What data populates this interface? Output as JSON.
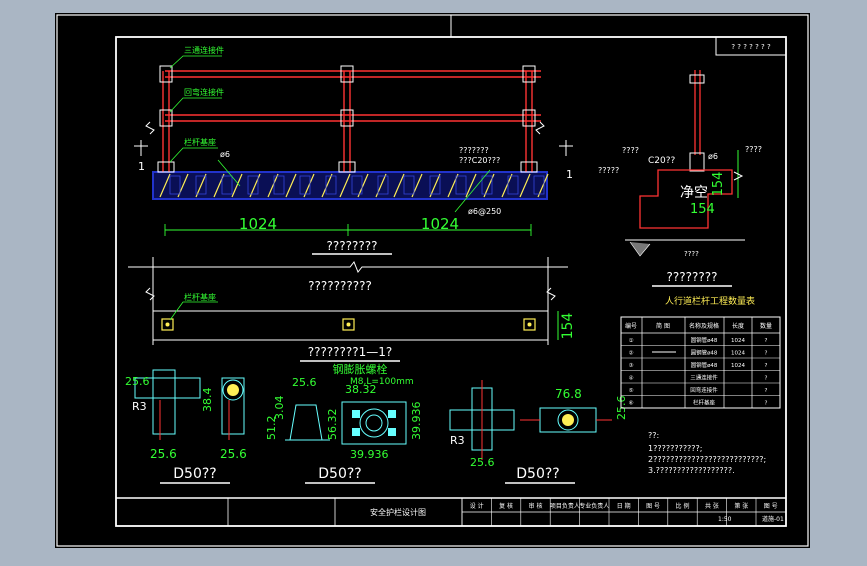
{
  "colors": {
    "frame_bg": "#aab6c4",
    "canvas": "#000000",
    "line_white": "#ffffff",
    "dim_green": "#33ff33",
    "rail_red": "#ff3333",
    "concrete_blue": "#2233cc",
    "pipe_cyan": "#66ffff",
    "label_yellow": "#ffee55"
  },
  "elevation": {
    "labels": {
      "three_way": "三通连接件",
      "return_elbow": "回弯连接件",
      "post_base": "栏杆基座",
      "phi6": "ø6",
      "concrete_note_1": "???????",
      "concrete_note_2": "???C20???",
      "rebar_spacing": "ø6@250"
    },
    "dim_left": "1024",
    "dim_right": "1024",
    "section_mark_left": "1",
    "section_mark_right": "1",
    "caption": "????????"
  },
  "plan": {
    "note": "??????????",
    "base_label": "栏杆基座",
    "dim_right": "154",
    "caption": "????????1—1?"
  },
  "section": {
    "top_left": "????",
    "top_mid_1": "????",
    "top_mid_2": "C20??",
    "phi6": "ø6",
    "top_right": "????",
    "left_note": "?????",
    "center_text": "净空",
    "dim_154_a": "154",
    "dim_154_b": "154",
    "bottom_note": "????",
    "caption": "????????"
  },
  "details": {
    "heading": "钢膨胀螺栓",
    "heading_spec": "M8,L=100mm",
    "d1": {
      "dim_top": "25.6",
      "dim_r": "R3",
      "dim_right": "38.4",
      "dim_b1": "25.6",
      "dim_b2": "25.6",
      "caption": "D50??"
    },
    "d2": {
      "dim_top": "25.6",
      "dim_top2": "38.32",
      "dim_l1": "51.2",
      "dim_l2": "3.04",
      "dim_l3": "56.32",
      "dim_r": "39.936",
      "dim_b": "39.936",
      "caption": "D50??"
    },
    "d3": {
      "dim_top": "76.8",
      "dim_r": "R3",
      "dim_right": "25.6",
      "dim_b": "25.6",
      "caption": "D50??"
    }
  },
  "table": {
    "title": "人行道栏杆工程数量表",
    "headers": [
      "编号",
      "简  图",
      "名称及规格",
      "长度",
      "数量"
    ],
    "rows": [
      {
        "no": "①",
        "name": "圆钢管ø48",
        "len": "1024",
        "qty": "?"
      },
      {
        "no": "②",
        "name": "圆钢管ø48",
        "len": "1024",
        "qty": "?"
      },
      {
        "no": "③",
        "name": "圆钢管ø48",
        "len": "1024",
        "qty": "?"
      },
      {
        "no": "④",
        "name": "三通连接件",
        "len": "",
        "qty": "?"
      },
      {
        "no": "⑤",
        "name": "回弯连接件",
        "len": "",
        "qty": "?"
      },
      {
        "no": "⑥",
        "name": "栏杆基座",
        "len": "",
        "qty": "?"
      }
    ]
  },
  "notes": {
    "head": "??:",
    "n1": "1???????????;",
    "n2": "2??????????????????????????;",
    "n3": "3.??????????????????."
  },
  "title_block": {
    "drawing_name": "安全护栏设计图",
    "cells": [
      "设 计",
      "复 核",
      "审 核",
      "项目负责人",
      "专业负责人",
      "日 期",
      "图 号",
      "比 例",
      "共 张",
      "第 张",
      "图 号"
    ],
    "scale": "1:50",
    "sheet": "道施-01"
  },
  "top_right_box": "? ? ? ? ? ? ?"
}
